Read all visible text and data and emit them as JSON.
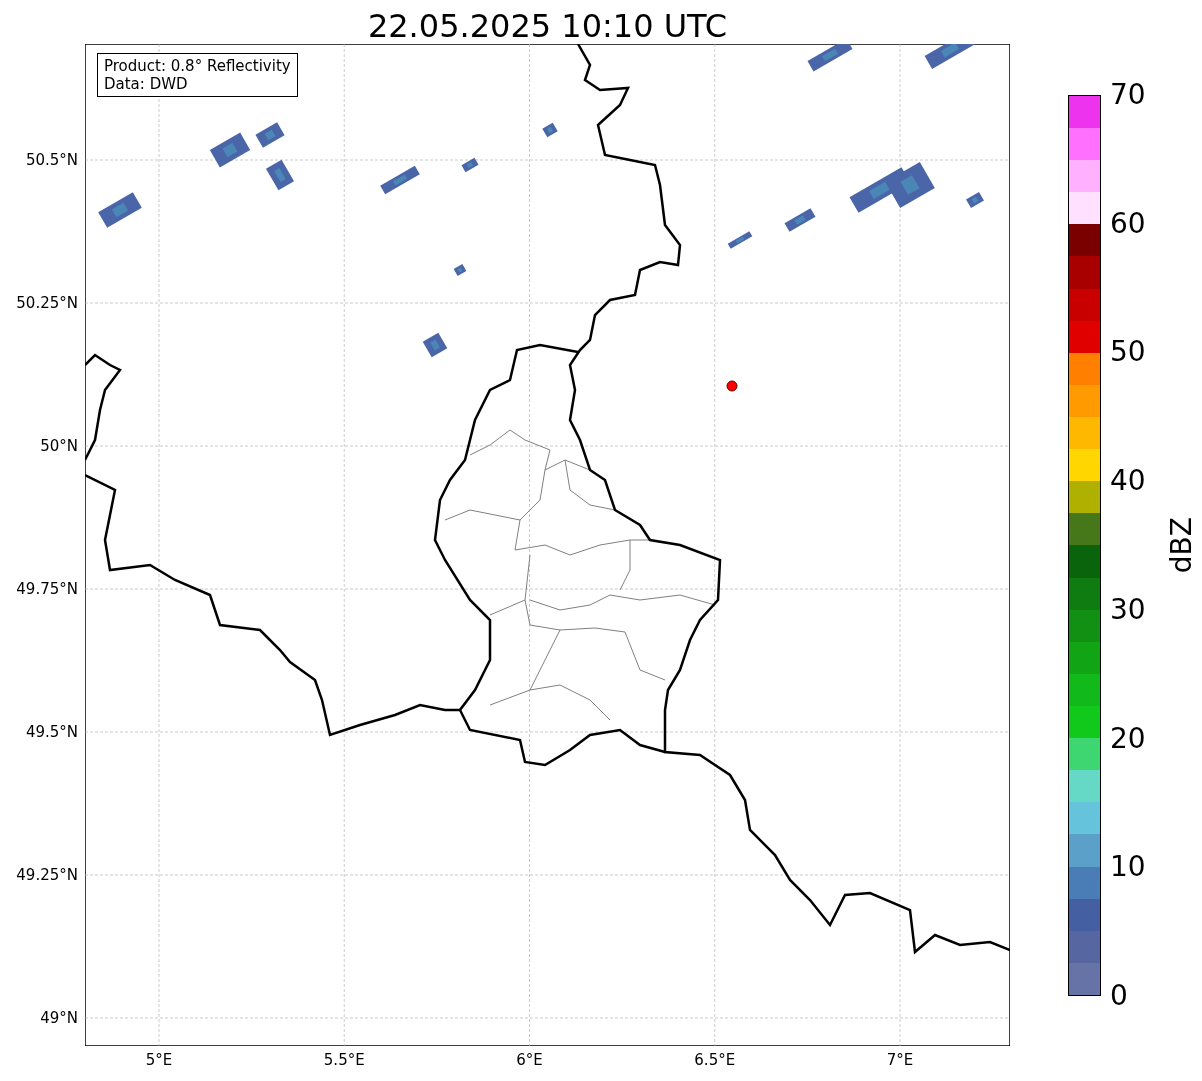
{
  "title": "22.05.2025 10:10 UTC",
  "legend": [
    "Product: 0.8° Reflectivity",
    "Data: DWD"
  ],
  "y_ticks": [
    "50.5°N",
    "50.25°N",
    "50°N",
    "49.75°N",
    "49.5°N",
    "49.25°N",
    "49°N"
  ],
  "x_ticks": [
    "5°E",
    "5.5°E",
    "6°E",
    "6.5°E",
    "7°E"
  ],
  "colorbar": {
    "label": "dBZ",
    "ticks": [
      "70",
      "60",
      "50",
      "40",
      "30",
      "20",
      "10",
      "0"
    ]
  }
}
